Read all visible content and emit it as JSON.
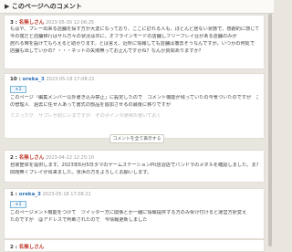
{
  "page_title": "このページへのコメント",
  "show_more_label": "コメントを全て表示する",
  "comments": [
    {
      "number": "3 :",
      "name": "名無しさん",
      "date": "2023-05-30 12:06:25",
      "lines": [
        "もはや、プレー出来る店舗を探す方が大変になっており、ここに訂れる人も、ほとんど居ない状態で、感謝的に感じてます。",
        "今の僕だと店舗移行はサル方々の状況は共に、オフラインモードの店舗しフリーブレイ台がある店舗のみが",
        "居れる時を設けてもらえると助かります。とは言え、近所に情報しても店舗は撤去そうなんですが。いつかの何処で",
        "店舗も出していかの？・・・ネットの失敗無ってお止んですかね？なんか質問ありますか？"
      ]
    },
    {
      "number": "10 :",
      "name": "oreka_3",
      "date": "2023-05-18 17:08:21",
      "badge": "+1",
      "lines": [
        "このページ「編集メンバー以外書き込み禁止」に設定したので　コメント機能が残っていたの今気づいたのですが　ここ",
        "の管理人　過去に任せ人あって書式の部品を追加させるの最後に移りですが",
        "ミスったグ　サプレゼ初にいまですが　そのポインタ通常の書いておく"
      ]
    },
    {
      "number": "2 :",
      "name": "名無しさん",
      "date": "2023-04-22 12:25:10",
      "lines": [
        "自家筐体を提供します。2023年6月5日タマのゲームステーションPit店浴店でパンドラのメダルを確認しました。また、",
        "問題無くプレイが出来ました。京浜の方をよろしくお願いします。"
      ]
    },
    {
      "number": "1 :",
      "name": "oreka_3",
      "date": "2023-05-18 17:08:21",
      "badge": "+1",
      "lines": [
        "このページメント機能をつけて　ツイッター方に関係とか一緒に情報提供する方のみ受け付けると運営方針変え",
        "たのですが　@アドレスで判断されたので　今情報更新しました"
      ]
    },
    {
      "number": "2 :",
      "name": "名無しさん",
      "date": ""
    }
  ]
}
